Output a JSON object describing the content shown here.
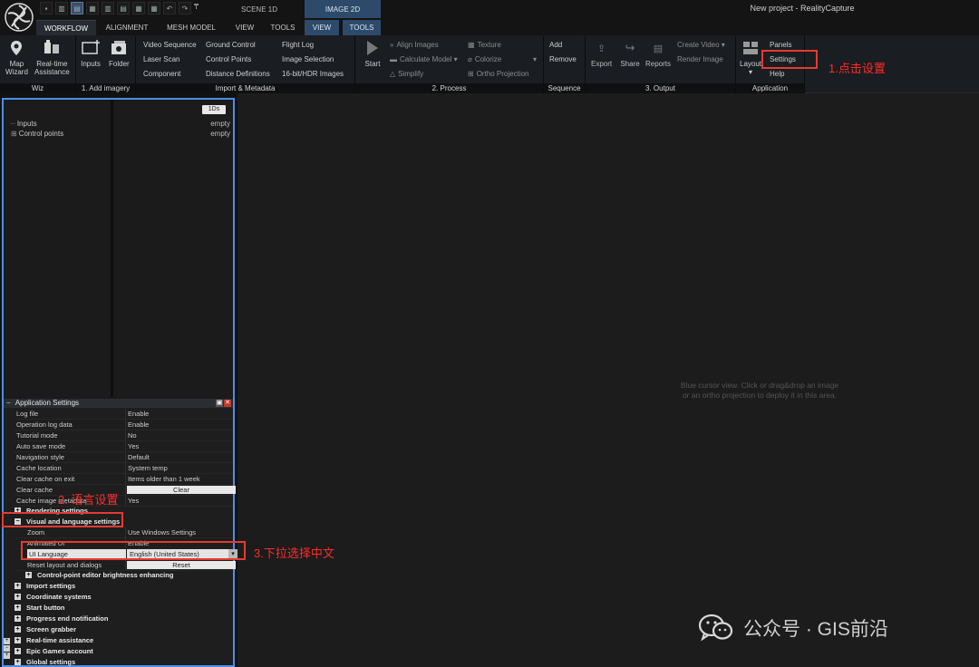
{
  "window": {
    "title": "New project - RealityCapture",
    "scene_tab": "SCENE 1D",
    "image_tab": "IMAGE 2D",
    "pin": "₸"
  },
  "menu_tabs": [
    "WORKFLOW",
    "ALIGNMENT",
    "MESH MODEL",
    "VIEW",
    "TOOLS",
    "VIEW",
    "TOOLS"
  ],
  "ribbon": {
    "wiz": {
      "label": "Wiz",
      "map_wizard": "Map\nWizard",
      "realtime": "Real-time\nAssistance"
    },
    "add_imagery": {
      "label": "1. Add imagery",
      "inputs": "Inputs",
      "folder": "Folder"
    },
    "import_metadata": {
      "label": "Import & Metadata",
      "col1": [
        "Video Sequence",
        "Laser Scan",
        "Component"
      ],
      "col2": [
        "Ground Control",
        "Control Points",
        "Distance Definitions"
      ],
      "col3": [
        "Flight Log",
        "Image Selection",
        "16-bit/HDR Images"
      ]
    },
    "process": {
      "label": "2. Process",
      "start": "Start",
      "col1": [
        "Align Images",
        "Calculate Model ▾",
        "Simplify"
      ],
      "col2": [
        "Texture",
        "Colorize",
        "Ortho Projection"
      ],
      "arrow": "▾"
    },
    "sequence": {
      "label": "Sequence",
      "add": "Add",
      "remove": "Remove"
    },
    "output": {
      "label": "3. Output",
      "export": "Export",
      "share": "Share",
      "reports": "Reports",
      "create_video": "Create Video ▾",
      "render_image": "Render Image"
    },
    "application": {
      "label": "Application",
      "layout": "Layout",
      "layout_arrow": "▾",
      "panels": "Panels",
      "settings": "Settings",
      "help": "Help"
    }
  },
  "left_panel": {
    "tree": [
      "Inputs",
      "Control points"
    ],
    "badge": "1Ds",
    "empty1": "empty",
    "empty2": "empty"
  },
  "app_settings": {
    "title": "Application Settings",
    "rows": [
      {
        "key": "Log file",
        "value": "Enable"
      },
      {
        "key": "Operation log data",
        "value": "Enable"
      },
      {
        "key": "Tutorial mode",
        "value": "No"
      },
      {
        "key": "Auto save mode",
        "value": "Yes"
      },
      {
        "key": "Navigation style",
        "value": "Default"
      },
      {
        "key": "Cache location",
        "value": "System temp"
      },
      {
        "key": "Clear cache on exit",
        "value": "Items older than 1 week"
      }
    ],
    "clear_cache": {
      "key": "Clear cache",
      "button": "Clear"
    },
    "cache_metadata": {
      "key": "Cache image metadata",
      "value": "Yes"
    },
    "rendering": "Rendering settings",
    "visual": "Visual and language settings",
    "zoom": {
      "key": "Zoom",
      "value": "Use Windows Settings"
    },
    "animated": {
      "key": "Animated UI",
      "value": "Enable"
    },
    "ui_language": {
      "key": "UI Language",
      "value": "English (United States)"
    },
    "reset": {
      "key": "Reset layout and dialogs",
      "button": "Reset"
    },
    "cp_brightness": "Control-point editor brightness enhancing",
    "sections": [
      "Import settings",
      "Coordinate systems",
      "Start button",
      "Progress end notification",
      "Screen grabber",
      "Real-time assistance",
      "Epic Games account",
      "Global settings"
    ]
  },
  "annotations": {
    "step1": "1.点击设置",
    "step2": "2. 语言设置",
    "step3": "3.下拉选择中文",
    "color": "#e53b30"
  },
  "viewport": {
    "hint": "Blue cursor view. Click or drag&drop an image or an ortho projection to deploy it in this area."
  },
  "watermark": "公众号 · GIS前沿",
  "colors": {
    "accent_blue": "#4d8fe6",
    "tab_blue": "#2d4a6a",
    "annotation_red": "#e53b30"
  }
}
